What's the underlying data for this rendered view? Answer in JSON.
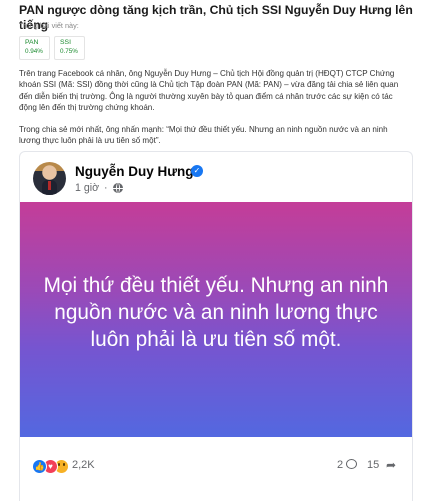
{
  "article": {
    "title": "PAN ngược dòng tăng kịch trần, Chủ tịch SSI Nguyễn Duy Hưng lên tiếng",
    "in_article_label": "Trong bài viết này:",
    "tickers": [
      {
        "symbol": "PAN",
        "change": "0.94%"
      },
      {
        "symbol": "SSI",
        "change": "0.75%"
      }
    ],
    "paragraphs": [
      "Trên trang Facebook cá nhân, ông Nguyễn Duy Hưng – Chủ tịch Hội đồng quản trị (HĐQT) CTCP Chứng khoán SSI (Mã: SSI) đồng thời cũng là Chủ tịch Tập đoàn PAN (Mã: PAN) – vừa đăng tải chia sẻ liên quan đến diễn biến thị trường. Ông là người thường xuyên bày tỏ quan điểm cá nhân trước các sự kiện có tác động lên đến thị trường chứng khoán.",
      "Trong chia sẻ mới nhất, ông nhấn mạnh: “Mọi thứ đều thiết yếu. Nhưng an ninh nguồn nước và an ninh lương thực luôn phải là ưu tiên số một”."
    ]
  },
  "post": {
    "author": "Nguyễn Duy Hưng",
    "verified_icon": "verified-check-icon",
    "time": "1 giờ",
    "time_separator": "·",
    "privacy_icon": "globe-icon",
    "content": "Mọi thứ đều thiết yếu. Nhưng an ninh nguồn nước và an ninh lương thực luôn phải là ưu tiên số một.",
    "background_colors": [
      "#c43d98",
      "#7655d0",
      "#5368e0"
    ],
    "reactions": {
      "count": "2,2K",
      "icons": [
        "like-icon",
        "love-icon",
        "wow-icon"
      ],
      "comments": "2",
      "shares": "15"
    }
  }
}
